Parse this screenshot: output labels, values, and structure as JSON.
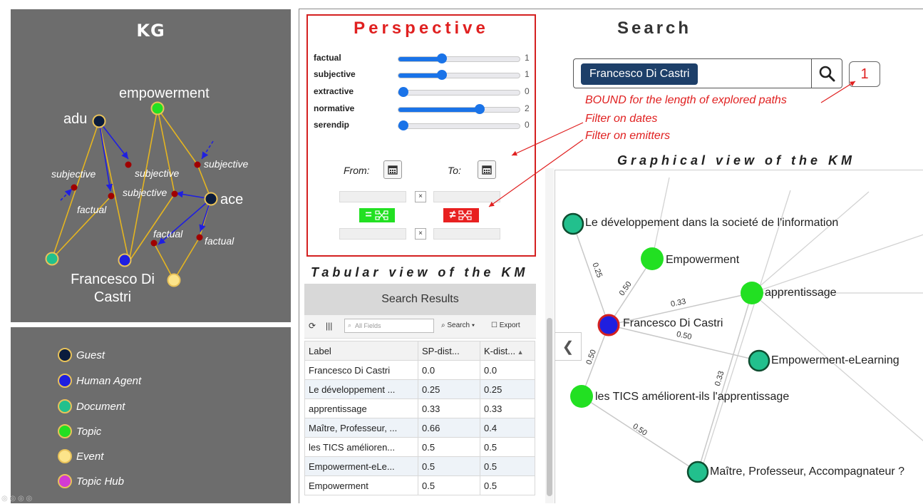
{
  "kg": {
    "title": "KG",
    "labels": {
      "empowerment": "empowerment",
      "adu": "adu",
      "ace": "ace",
      "person": "Francesco Di Castri",
      "subjective": "subjective",
      "factual": "factual"
    }
  },
  "legend": {
    "items": [
      {
        "label": "Guest",
        "color": "#0b1c3d",
        "border": "#e8c25a"
      },
      {
        "label": "Human Agent",
        "color": "#1f1fe0",
        "border": "#e8c25a"
      },
      {
        "label": "Document",
        "color": "#22c08d",
        "border": "#e8c25a"
      },
      {
        "label": "Topic",
        "color": "#22e022",
        "border": "#e8c25a"
      },
      {
        "label": "Event",
        "color": "#fce48a",
        "border": "#e8c25a"
      },
      {
        "label": "Topic Hub",
        "color": "#d23bd2",
        "border": "#e8c25a"
      }
    ]
  },
  "perspective": {
    "title": "Perspective",
    "sliders": [
      {
        "label": "factual",
        "value": "1",
        "fraction": 0.36
      },
      {
        "label": "subjective",
        "value": "1",
        "fraction": 0.36
      },
      {
        "label": "extractive",
        "value": "0",
        "fraction": 0.04
      },
      {
        "label": "normative",
        "value": "2",
        "fraction": 0.67
      },
      {
        "label": "serendip",
        "value": "0",
        "fraction": 0.04
      }
    ],
    "from_label": "From:",
    "to_label": "To:",
    "eq_symbol": "=",
    "neq_symbol": "≠",
    "x_symbol": "×"
  },
  "search": {
    "title": "Search",
    "query": "Francesco Di Castri",
    "bound": "1"
  },
  "notes": {
    "bound": "BOUND for the length of explored paths",
    "dates": "Filter on dates",
    "emitters": "Filter on emitters"
  },
  "graph": {
    "title": "Graphical view of the KM",
    "nodes": {
      "doc1": "Le développement dans la societé de l'information",
      "empowerment": "Empowerment",
      "apprentissage": "apprentissage",
      "person": "Francesco Di Castri",
      "elearning": "Empowerment-eLearning",
      "tics": "les TICS améliorent-ils l'apprentissage",
      "maitre": "Maître, Professeur, Accompagnateur ?"
    },
    "edges": {
      "e1": "0.25",
      "e2": "0.50",
      "e3": "0.33",
      "e4": "0.50",
      "e5": "0.50",
      "e6": "0.33",
      "e7": "0.50"
    }
  },
  "tabular": {
    "title": "Tabular view of the KM",
    "header": "Search Results",
    "toolbar": {
      "search_placeholder": "All Fields",
      "search_label": "Search",
      "export_label": "Export"
    },
    "columns": [
      "Label",
      "SP-dist...",
      "K-dist..."
    ],
    "rows": [
      [
        "Francesco Di Castri",
        "0.0",
        "0.0"
      ],
      [
        "Le développement ...",
        "0.25",
        "0.25"
      ],
      [
        "apprentissage",
        "0.33",
        "0.33"
      ],
      [
        "Maître, Professeur, ...",
        "0.66",
        "0.4"
      ],
      [
        "les TICS amélioren...",
        "0.5",
        "0.5"
      ],
      [
        "Empowerment-eLe...",
        "0.5",
        "0.5"
      ],
      [
        "Empowerment",
        "0.5",
        "0.5"
      ]
    ]
  }
}
